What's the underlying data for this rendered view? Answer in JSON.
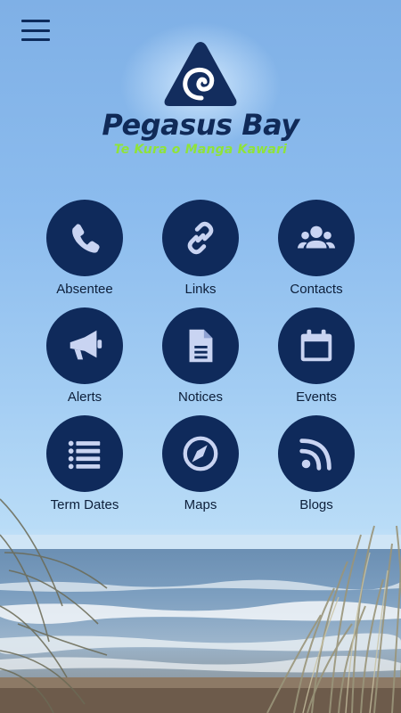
{
  "header": {
    "menu_icon": "hamburger-icon"
  },
  "logo": {
    "brand": "Pegasus Bay",
    "tagline": "Te Kura o Manga Kawari",
    "brand_color": "#102a58",
    "tagline_color": "#8fe33a"
  },
  "tiles": [
    {
      "label": "Absentee",
      "icon": "phone-icon"
    },
    {
      "label": "Links",
      "icon": "link-icon"
    },
    {
      "label": "Contacts",
      "icon": "users-icon"
    },
    {
      "label": "Alerts",
      "icon": "megaphone-icon"
    },
    {
      "label": "Notices",
      "icon": "document-icon"
    },
    {
      "label": "Events",
      "icon": "calendar-icon"
    },
    {
      "label": "Term Dates",
      "icon": "list-icon"
    },
    {
      "label": "Maps",
      "icon": "compass-icon"
    },
    {
      "label": "Blogs",
      "icon": "rss-icon"
    }
  ],
  "colors": {
    "tile_background": "#0f2a5b",
    "icon_color": "#c9d4f2",
    "label_color": "#0d1f3a"
  }
}
